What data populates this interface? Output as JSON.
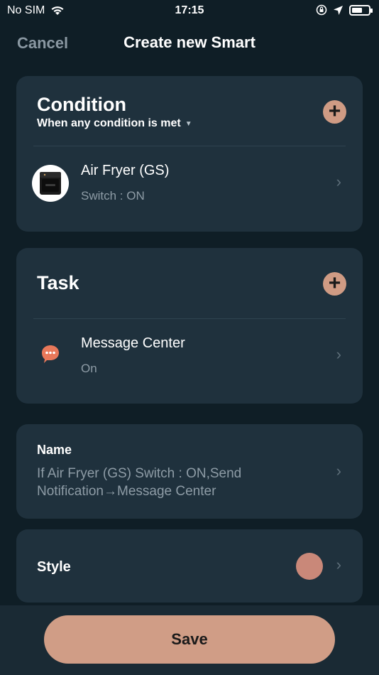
{
  "status_bar": {
    "carrier": "No SIM",
    "time": "17:15"
  },
  "nav": {
    "cancel_label": "Cancel",
    "title": "Create new Smart"
  },
  "condition": {
    "title": "Condition",
    "mode": "When any condition is met",
    "items": [
      {
        "title": "Air Fryer (GS)",
        "subtitle": "Switch : ON"
      }
    ]
  },
  "task": {
    "title": "Task",
    "items": [
      {
        "title": "Message Center",
        "subtitle": "On"
      }
    ]
  },
  "name": {
    "label": "Name",
    "value": "If Air Fryer (GS) Switch : ON,Send Notification→Message Center"
  },
  "style": {
    "label": "Style",
    "color": "#c98879"
  },
  "save_label": "Save",
  "colors": {
    "background": "#0f1e26",
    "card": "#1f313d",
    "accent": "#cf9b84"
  }
}
